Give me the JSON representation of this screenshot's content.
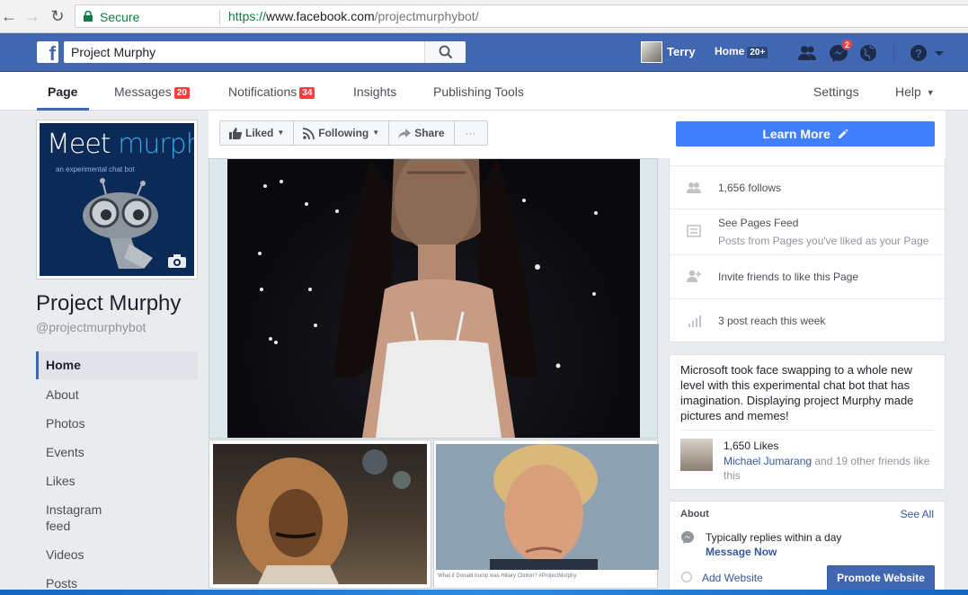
{
  "browser": {
    "secure_label": "Secure",
    "url_scheme": "https://",
    "url_host": "www.facebook.com",
    "url_path": "/projectmurphybot/"
  },
  "topbar": {
    "logo": "f",
    "search_value": "Project Murphy",
    "user_name": "Terry",
    "home_label": "Home",
    "home_count": "20+",
    "messages_badge": "2"
  },
  "page_tabs": {
    "page": "Page",
    "messages": "Messages",
    "messages_count": "20",
    "notifications": "Notifications",
    "notifications_count": "34",
    "insights": "Insights",
    "publishing_tools": "Publishing Tools",
    "settings": "Settings",
    "help": "Help"
  },
  "profile": {
    "pic_title_a": "Meet ",
    "pic_title_b": "murphy",
    "pic_subtitle": "an experimental chat bot",
    "name": "Project Murphy",
    "handle": "@projectmurphybot"
  },
  "left_nav": [
    "Home",
    "About",
    "Photos",
    "Events",
    "Likes",
    "Instagram",
    "feed",
    "Videos",
    "Posts"
  ],
  "actions": {
    "liked": "Liked",
    "following": "Following",
    "share": "Share",
    "more": "···",
    "learn_more": "Learn More"
  },
  "photos": {
    "caption": "What if Donald trump was Hillary Clinton? #ProjectMurphy"
  },
  "stats": {
    "follows": "1,656 follows",
    "pages_feed_title": "See Pages Feed",
    "pages_feed_sub": "Posts from Pages you've liked as your Page",
    "invite": "Invite friends to like this Page",
    "reach": "3 post reach this week"
  },
  "story": {
    "text": "Microsoft took face swapping to a whole new level with this experimental chat bot that has imagination. Displaying project Murphy made pictures and memes!",
    "likes": "1,650 Likes",
    "friend_name": "Michael Jumarang",
    "friends_rest": " and 19 other friends like this"
  },
  "about": {
    "heading": "About",
    "see_all": "See All",
    "reply": "Typically replies within a day",
    "message_now": "Message Now",
    "add_website": "Add Website",
    "promote": "Promote Website"
  },
  "colors": {
    "facebook_blue": "#4267b2",
    "learn_more_blue": "#4080ff",
    "badge_red": "#fa3e3e",
    "secure_green": "#0b8043"
  }
}
